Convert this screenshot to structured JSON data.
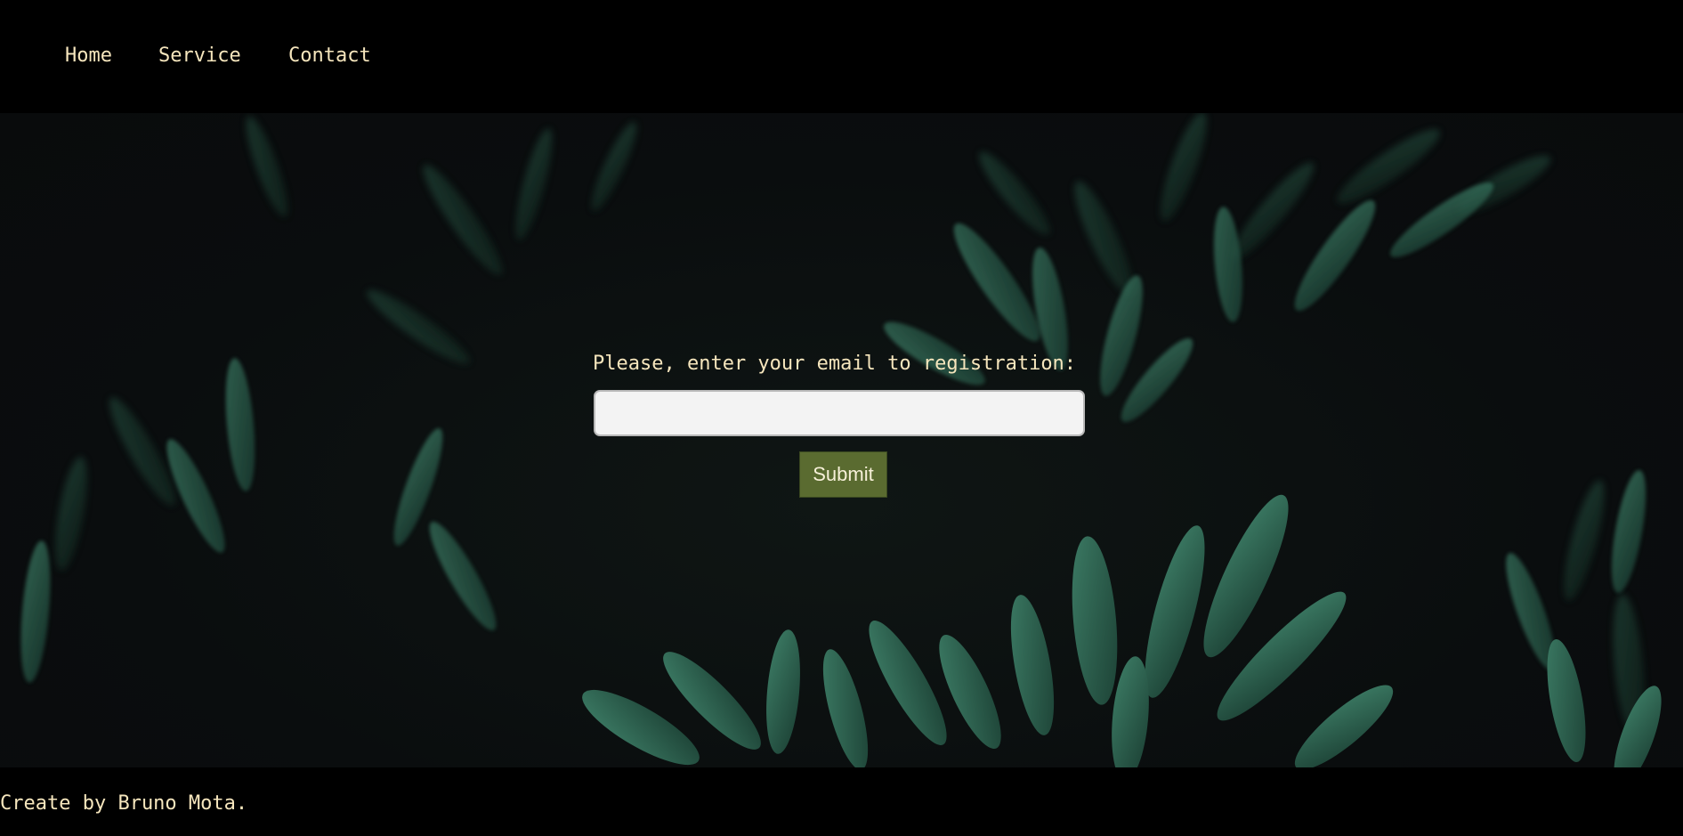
{
  "nav": {
    "items": [
      {
        "label": "Home"
      },
      {
        "label": "Service"
      },
      {
        "label": "Contact"
      }
    ]
  },
  "form": {
    "label": "Please, enter your email to registration:",
    "email_value": "",
    "submit_label": "Submit"
  },
  "footer": {
    "text": "Create by Bruno Mota."
  },
  "colors": {
    "text": "#f6e6bd",
    "button": "#5a6b30",
    "background": "#000000",
    "hero_background": "#0a0d0e",
    "leaf": "#2f6b55"
  }
}
